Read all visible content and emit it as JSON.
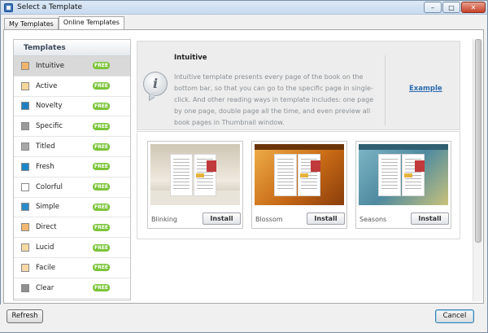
{
  "window": {
    "title": "Select a Template",
    "controls": {
      "minimize": "–",
      "maximize": "□",
      "close": "✕"
    }
  },
  "tabs": [
    {
      "label": "My Templates",
      "active": false
    },
    {
      "label": "Online Templates",
      "active": true
    }
  ],
  "sidebar": {
    "header": "Templates",
    "badge": "FREE",
    "items": [
      {
        "name": "Intuitive",
        "color": "#f2b46a",
        "selected": true
      },
      {
        "name": "Active",
        "color": "#f4d79a",
        "selected": false
      },
      {
        "name": "Novelty",
        "color": "#1f7fc0",
        "selected": false
      },
      {
        "name": "Specific",
        "color": "#9a9a9a",
        "selected": false
      },
      {
        "name": "Titled",
        "color": "#a7a7a7",
        "selected": false
      },
      {
        "name": "Fresh",
        "color": "#1d86c6",
        "selected": false
      },
      {
        "name": "Colorful",
        "color": "#ffffff",
        "selected": false
      },
      {
        "name": "Simple",
        "color": "#2a8cc9",
        "selected": false
      },
      {
        "name": "Direct",
        "color": "#f3b771",
        "selected": false
      },
      {
        "name": "Lucid",
        "color": "#f5d9a2",
        "selected": false
      },
      {
        "name": "Facile",
        "color": "#f7d7a6",
        "selected": false
      },
      {
        "name": "Clear",
        "color": "#8f8f8f",
        "selected": false
      }
    ]
  },
  "detail": {
    "icon": "info-bubble-icon",
    "title": "Intuitive",
    "description": "Intuitive template presents every page of the book on the bottom bar, so that you can go to the specific page in single-click. And other reading ways in template includes: one page by one page, double page all the time, and even preview all book pages in Thumbnail window.",
    "example_link": "Example"
  },
  "cards": [
    {
      "name": "Blinking",
      "install_label": "Install",
      "bg": "#d9d1c2",
      "accent": "#8f8576"
    },
    {
      "name": "Blossom",
      "install_label": "Install",
      "bg": "#d78a2a",
      "accent": "#7a3e0c"
    },
    {
      "name": "Seasons",
      "install_label": "Install",
      "bg": "#5b9bb0",
      "accent": "#2e5a6b"
    }
  ],
  "footer": {
    "refresh_label": "Refresh",
    "cancel_label": "Cancel"
  }
}
